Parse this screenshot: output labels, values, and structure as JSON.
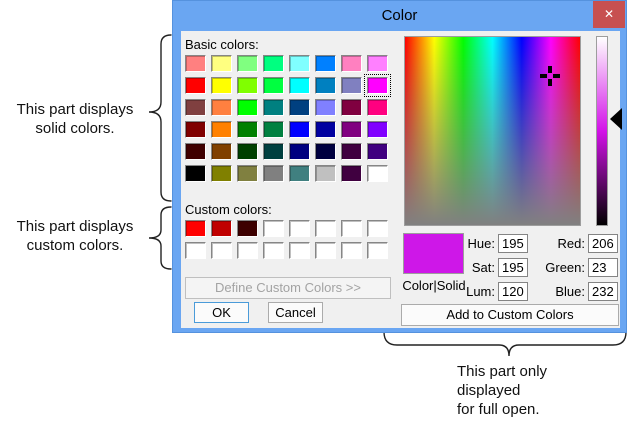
{
  "window": {
    "title": "Color",
    "close_icon": "✕"
  },
  "accent_colors": {
    "titlebar_blue": "#6aa6f2",
    "close_button_red": "#c75050",
    "client_gray": "#f0f0f0",
    "default_button_border": "#4a9bd9"
  },
  "dialog": {
    "basic_colors_label": "Basic colors:",
    "basic_colors": [
      "#FF8080",
      "#FFFF80",
      "#80FF80",
      "#00FF80",
      "#80FFFF",
      "#0080FF",
      "#FF80C0",
      "#FF80FF",
      "#FF0000",
      "#FFFF00",
      "#80FF00",
      "#00FF40",
      "#00FFFF",
      "#0080C0",
      "#8080C0",
      "#FF00FF",
      "#804040",
      "#FF8040",
      "#00FF00",
      "#008080",
      "#004080",
      "#8080FF",
      "#800040",
      "#FF0080",
      "#800000",
      "#FF8000",
      "#008000",
      "#008040",
      "#0000FF",
      "#0000A0",
      "#800080",
      "#8000FF",
      "#400000",
      "#804000",
      "#004000",
      "#004040",
      "#000080",
      "#000040",
      "#400040",
      "#400080",
      "#000000",
      "#808000",
      "#808040",
      "#808080",
      "#408080",
      "#C0C0C0",
      "#400040",
      "#FFFFFF"
    ],
    "selected_basic_index": 15,
    "custom_colors_label": "Custom colors:",
    "custom_colors": [
      "#FF0000",
      "#C00000",
      "#3D0000",
      "#FFFFFF",
      "#FFFFFF",
      "#FFFFFF",
      "#FFFFFF",
      "#FFFFFF",
      "#FFFFFF",
      "#FFFFFF",
      "#FFFFFF",
      "#FFFFFF",
      "#FFFFFF",
      "#FFFFFF",
      "#FFFFFF",
      "#FFFFFF"
    ],
    "define_button_label": "Define Custom Colors >>",
    "ok_button_label": "OK",
    "cancel_button_label": "Cancel",
    "add_button_label": "Add to Custom Colors",
    "preview": {
      "label": "Color|Solid",
      "color": "#CE17E8"
    },
    "fields": {
      "hue": {
        "label": "Hue:",
        "value": "195"
      },
      "sat": {
        "label": "Sat:",
        "value": "195"
      },
      "lum": {
        "label": "Lum:",
        "value": "120"
      },
      "red": {
        "label": "Red:",
        "value": "206"
      },
      "green": {
        "label": "Green:",
        "value": "23"
      },
      "blue": {
        "label": "Blue:",
        "value": "232"
      }
    }
  },
  "annotations": {
    "solid_note": "This part displays\nsolid colors.",
    "custom_note": "This part displays\ncustom colors.",
    "full_open_note": "This part only\ndisplayed\nfor full open."
  }
}
